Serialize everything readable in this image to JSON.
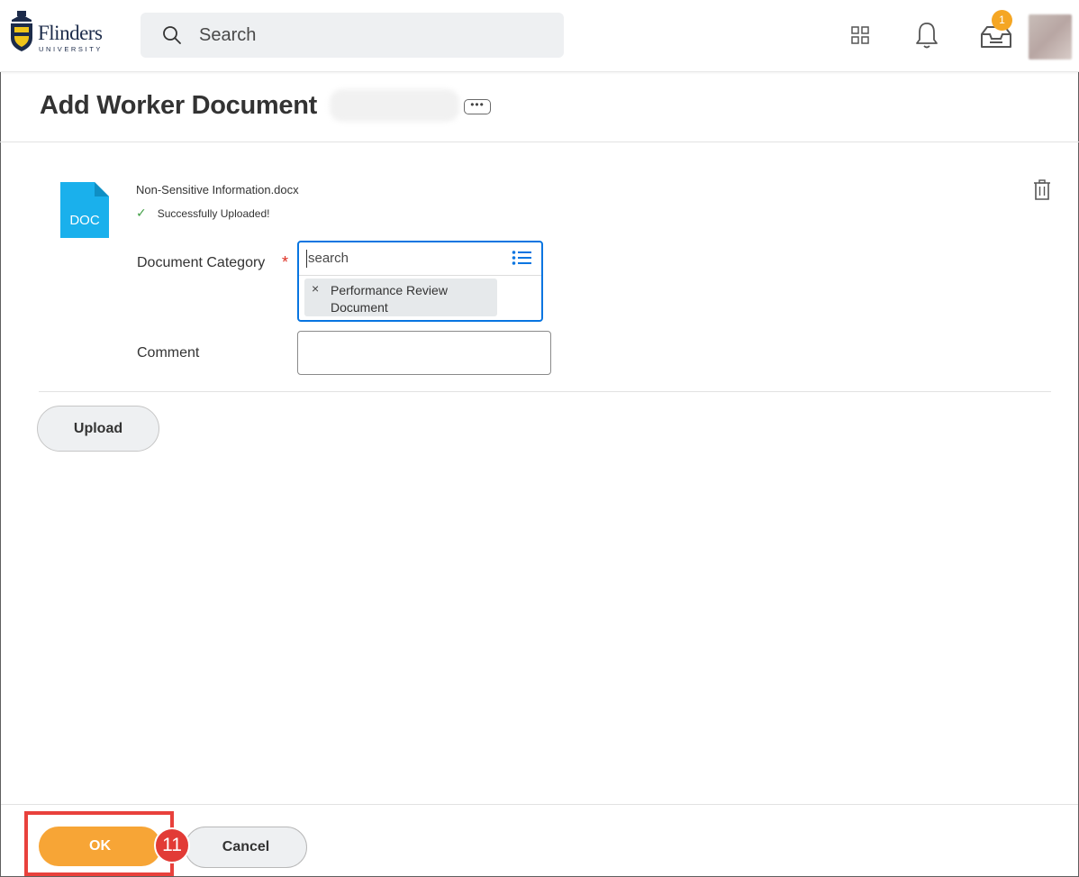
{
  "app": {
    "logo_word": "Flinders",
    "logo_subword": "UNIVERSITY"
  },
  "header": {
    "search_placeholder": "Search",
    "inbox_badge_count": "1"
  },
  "page": {
    "title": "Add Worker Document"
  },
  "document": {
    "icon_label": "DOC",
    "filename": "Non-Sensitive Information.docx",
    "status": "Successfully Uploaded!"
  },
  "form": {
    "category_label": "Document Category",
    "required_marker": "*",
    "category_search_placeholder": "search",
    "category_selected": "Performance Review Document",
    "pill_remove": "×",
    "comment_label": "Comment",
    "comment_value": ""
  },
  "actions": {
    "upload_label": "Upload",
    "ok_label": "OK",
    "cancel_label": "Cancel",
    "step_number": "11"
  },
  "colors": {
    "primary_action": "#f7a536",
    "highlight": "#e8413c",
    "focus_blue": "#0875e1",
    "doc_icon": "#1ab0ec",
    "success": "#43a047"
  }
}
